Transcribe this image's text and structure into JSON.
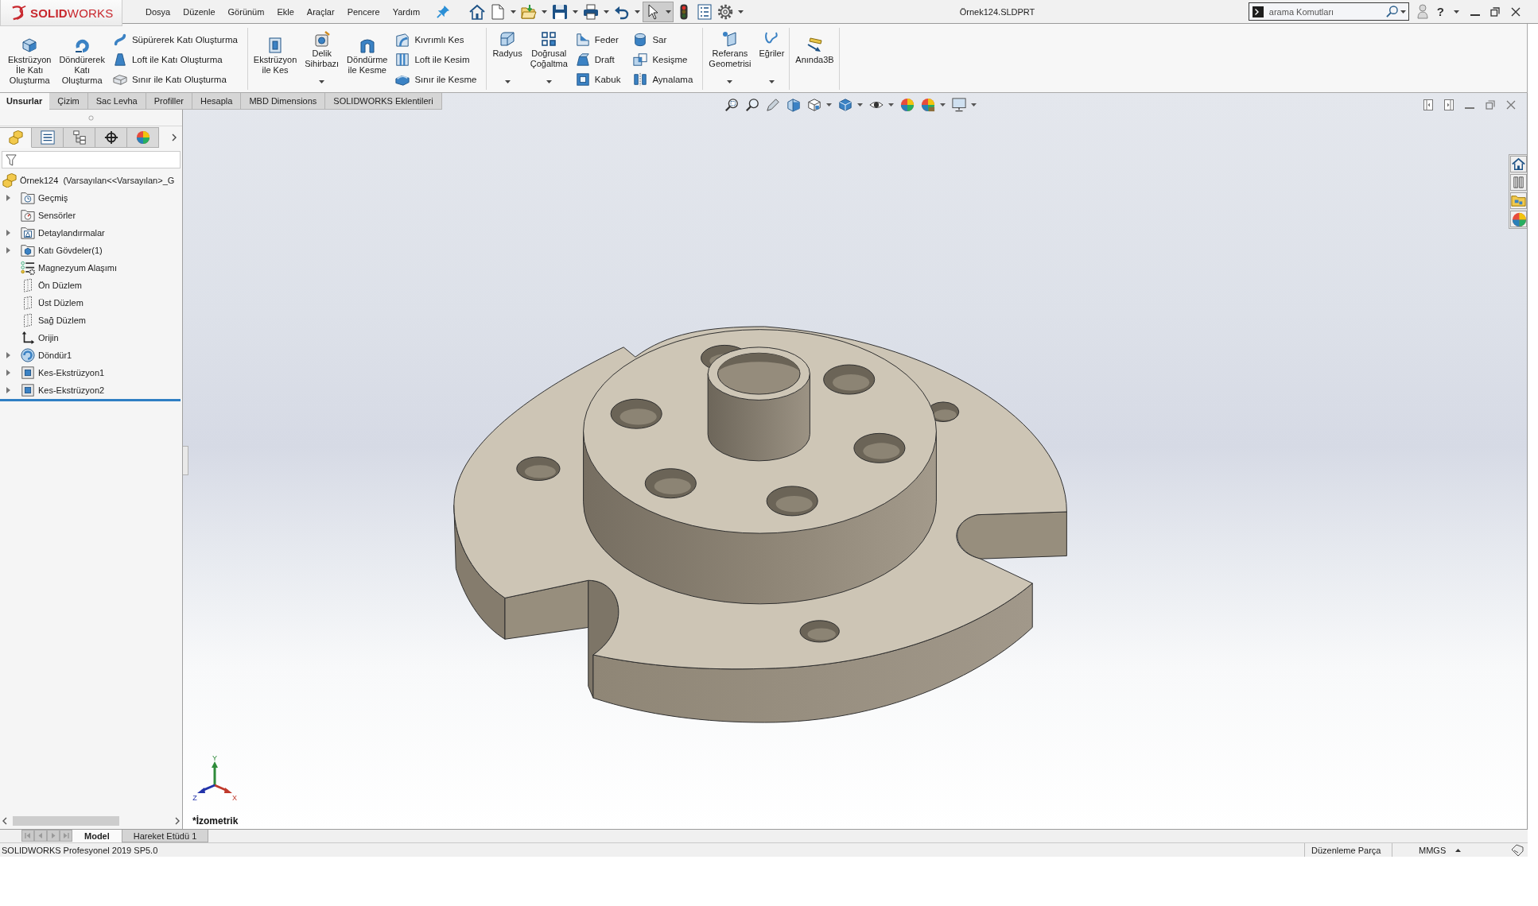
{
  "logo": "**SOLID**WORKS",
  "menu": [
    "Dosya",
    "Düzenle",
    "Görünüm",
    "Ekle",
    "Araçlar",
    "Pencere",
    "Yardım"
  ],
  "quick_access": [
    {
      "dropdown": false,
      "selected": false
    },
    {
      "dropdown": true,
      "selected": false
    },
    {
      "dropdown": true,
      "selected": false
    },
    {
      "dropdown": true,
      "selected": false
    },
    {
      "dropdown": true,
      "selected": false
    },
    {
      "dropdown": true,
      "selected": false
    },
    {
      "dropdown": true,
      "selected": true
    },
    {
      "dropdown": false,
      "selected": false
    },
    {
      "dropdown": false,
      "selected": false
    },
    {
      "dropdown": true,
      "selected": false
    }
  ],
  "document_title": "Örnek124.SLDPRT",
  "search": {
    "placeholder": "arama Komutları"
  },
  "help": "?",
  "ribbon": [
    {
      "blocks": [
        {
          "kind": "large",
          "label": "Ekstrüzyon\nİle Katı\nOluşturma",
          "dropdown": false
        },
        {
          "kind": "large",
          "label": "Döndürerek\nKatı\nOluşturma",
          "dropdown": false
        },
        {
          "kind": "stack",
          "items": [
            "Süpürerek Katı Oluşturma",
            "Loft ile Katı Oluşturma",
            "Sınır ile Katı Oluşturma"
          ]
        }
      ]
    },
    {
      "blocks": [
        {
          "kind": "large",
          "label": "Ekstrüzyon\nile Kes",
          "dropdown": false
        },
        {
          "kind": "large",
          "label": "Delik\nSihirbazı",
          "dropdown": true
        },
        {
          "kind": "large",
          "label": "Döndürme\nile Kesme",
          "dropdown": false
        },
        {
          "kind": "stack",
          "items": [
            "Kıvrımlı Kes",
            "Loft ile Kesim",
            "Sınır ile Kesme"
          ]
        }
      ]
    },
    {
      "blocks": [
        {
          "kind": "large",
          "label": "Radyus",
          "dropdown": true
        },
        {
          "kind": "large",
          "label": "Doğrusal\nÇoğaltma",
          "dropdown": true
        },
        {
          "kind": "stack",
          "items": [
            "Feder",
            "Draft",
            "Kabuk"
          ]
        },
        {
          "kind": "stack",
          "items": [
            "Sar",
            "Kesişme",
            "Aynalama"
          ]
        }
      ]
    },
    {
      "blocks": [
        {
          "kind": "large",
          "label": "Referans\nGeometrisi",
          "dropdown": true
        },
        {
          "kind": "large",
          "label": "Eğriler",
          "dropdown": true
        }
      ]
    },
    {
      "blocks": [
        {
          "kind": "large",
          "label": "Anında3B",
          "dropdown": false
        }
      ]
    }
  ],
  "command_tabs": [
    {
      "label": "Unsurlar",
      "selected": true
    },
    {
      "label": "Çizim",
      "selected": false
    },
    {
      "label": "Sac Levha",
      "selected": false
    },
    {
      "label": "Profiller",
      "selected": false
    },
    {
      "label": "Hesapla",
      "selected": false
    },
    {
      "label": "MBD Dimensions",
      "selected": false
    },
    {
      "label": "SOLIDWORKS Eklentileri",
      "selected": false
    }
  ],
  "feature_manager": {
    "tabs": [
      {
        "selected": true
      },
      {
        "selected": false
      },
      {
        "selected": false
      },
      {
        "selected": false
      },
      {
        "selected": false
      }
    ],
    "root": "Örnek124  (Varsayılan<<Varsayılan>_G",
    "items": [
      {
        "label": "Geçmiş",
        "expandable": true
      },
      {
        "label": "Sensörler",
        "expandable": false
      },
      {
        "label": "Detaylandırmalar",
        "expandable": true
      },
      {
        "label": "Katı Gövdeler(1)",
        "expandable": true
      },
      {
        "label": "Magnezyum Alaşımı",
        "expandable": false
      },
      {
        "label": "Ön Düzlem",
        "expandable": false
      },
      {
        "label": "Üst Düzlem",
        "expandable": false
      },
      {
        "label": "Sağ Düzlem",
        "expandable": false
      },
      {
        "label": "Orijin",
        "expandable": false
      },
      {
        "label": "Döndür1",
        "expandable": true
      },
      {
        "label": "Kes-Ekstrüzyon1",
        "expandable": true
      },
      {
        "label": "Kes-Ekstrüzyon2",
        "expandable": true
      }
    ]
  },
  "viewport": {
    "view_name": "*İzometrik",
    "axes": {
      "x": "X",
      "y": "Y",
      "z": "Z"
    }
  },
  "bottom_tabs": [
    {
      "label": "Model",
      "selected": true
    },
    {
      "label": "Hareket Etüdü 1",
      "selected": false
    }
  ],
  "status_bar": {
    "product": "SOLIDWORKS Profesyonel 2019 SP5.0",
    "mode": "Düzenleme Parça",
    "units": "MMGS"
  }
}
